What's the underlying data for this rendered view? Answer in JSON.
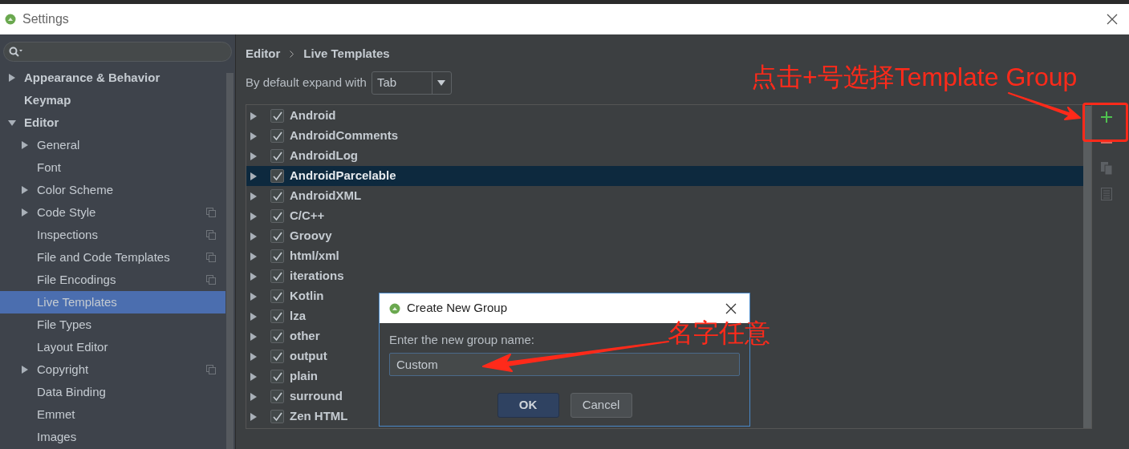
{
  "window": {
    "title": "Settings"
  },
  "sidebar": {
    "items": [
      {
        "label": "Appearance & Behavior",
        "expandable": true,
        "expanded": false,
        "selected": false,
        "project_icon": false
      },
      {
        "label": "Keymap",
        "expandable": false,
        "expanded": false,
        "selected": false,
        "project_icon": false
      },
      {
        "label": "Editor",
        "expandable": true,
        "expanded": true,
        "selected": false,
        "project_icon": false,
        "children": [
          {
            "label": "General",
            "expandable": true,
            "expanded": false,
            "selected": false,
            "project_icon": false
          },
          {
            "label": "Font",
            "expandable": false,
            "expanded": false,
            "selected": false,
            "project_icon": false
          },
          {
            "label": "Color Scheme",
            "expandable": true,
            "expanded": false,
            "selected": false,
            "project_icon": false
          },
          {
            "label": "Code Style",
            "expandable": true,
            "expanded": false,
            "selected": false,
            "project_icon": true
          },
          {
            "label": "Inspections",
            "expandable": false,
            "expanded": false,
            "selected": false,
            "project_icon": true
          },
          {
            "label": "File and Code Templates",
            "expandable": false,
            "expanded": false,
            "selected": false,
            "project_icon": true
          },
          {
            "label": "File Encodings",
            "expandable": false,
            "expanded": false,
            "selected": false,
            "project_icon": true
          },
          {
            "label": "Live Templates",
            "expandable": false,
            "expanded": false,
            "selected": true,
            "project_icon": false
          },
          {
            "label": "File Types",
            "expandable": false,
            "expanded": false,
            "selected": false,
            "project_icon": false
          },
          {
            "label": "Layout Editor",
            "expandable": false,
            "expanded": false,
            "selected": false,
            "project_icon": false
          },
          {
            "label": "Copyright",
            "expandable": true,
            "expanded": false,
            "selected": false,
            "project_icon": true
          },
          {
            "label": "Data Binding",
            "expandable": false,
            "expanded": false,
            "selected": false,
            "project_icon": false
          },
          {
            "label": "Emmet",
            "expandable": false,
            "expanded": false,
            "selected": false,
            "project_icon": false
          },
          {
            "label": "Images",
            "expandable": false,
            "expanded": false,
            "selected": false,
            "project_icon": false
          }
        ]
      }
    ]
  },
  "breadcrumb": [
    "Editor",
    "Live Templates"
  ],
  "expand_with": {
    "label": "By default expand with",
    "value": "Tab"
  },
  "templates": [
    {
      "label": "Android",
      "checked": true,
      "selected": false
    },
    {
      "label": "AndroidComments",
      "checked": true,
      "selected": false
    },
    {
      "label": "AndroidLog",
      "checked": true,
      "selected": false
    },
    {
      "label": "AndroidParcelable",
      "checked": true,
      "selected": true
    },
    {
      "label": "AndroidXML",
      "checked": true,
      "selected": false
    },
    {
      "label": "C/C++",
      "checked": true,
      "selected": false
    },
    {
      "label": "Groovy",
      "checked": true,
      "selected": false
    },
    {
      "label": "html/xml",
      "checked": true,
      "selected": false
    },
    {
      "label": "iterations",
      "checked": true,
      "selected": false
    },
    {
      "label": "Kotlin",
      "checked": true,
      "selected": false
    },
    {
      "label": "lza",
      "checked": true,
      "selected": false
    },
    {
      "label": "other",
      "checked": true,
      "selected": false
    },
    {
      "label": "output",
      "checked": true,
      "selected": false
    },
    {
      "label": "plain",
      "checked": true,
      "selected": false
    },
    {
      "label": "surround",
      "checked": true,
      "selected": false
    },
    {
      "label": "Zen HTML",
      "checked": true,
      "selected": false
    }
  ],
  "toolbar": [
    {
      "kind": "add",
      "disabled": false
    },
    {
      "kind": "remove",
      "disabled": false
    },
    {
      "kind": "copy",
      "disabled": true
    },
    {
      "kind": "edit",
      "disabled": true
    }
  ],
  "dialog": {
    "title": "Create New Group",
    "prompt": "Enter the new group name:",
    "value": "Custom",
    "buttons": [
      {
        "label": "OK",
        "default": true
      },
      {
        "label": "Cancel",
        "default": false
      }
    ]
  },
  "annotations": [
    {
      "text": "点击+号选择Template Group"
    },
    {
      "text": "名字任意"
    }
  ]
}
